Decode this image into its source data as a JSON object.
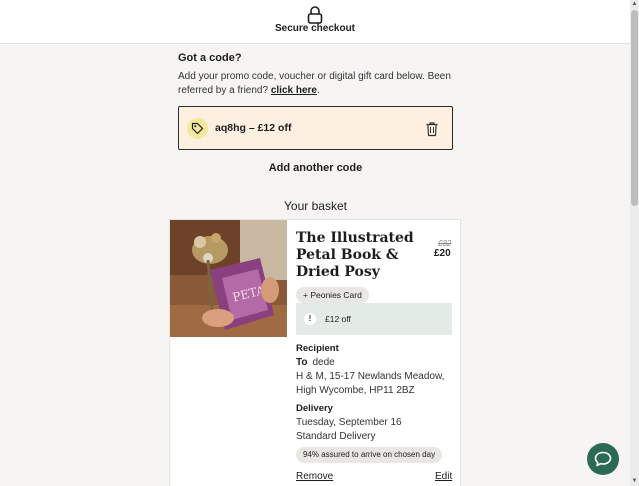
{
  "header": {
    "title": "Secure checkout",
    "icon": "lock-icon"
  },
  "promo": {
    "heading": "Got a code?",
    "description": "Add your promo code, voucher or digital gift card below. Been referred by a friend?",
    "referral_link": "click here",
    "referral_suffix": ".",
    "applied_code": "aq8hg – £12 off",
    "add_another": "Add another code"
  },
  "basket": {
    "title": "Your basket",
    "item": {
      "name": "The Illustrated Petal Book & Dried Posy",
      "price_old": "£32",
      "price_new": "£20",
      "addon": "+ Peonies Card",
      "discount": "£12 off",
      "recipient_heading": "Recipient",
      "to_label": "To",
      "to_name": "dede",
      "address_line1": "H & M, 15-17 Newlands Meadow,",
      "address_line2": "High Wycombe, HP11 2BZ",
      "delivery_heading": "Delivery",
      "delivery_date": "Tuesday, September 16",
      "delivery_type": "Standard Delivery",
      "assurance": "94% assured to arrive on chosen day",
      "remove_label": "Remove",
      "edit_label": "Edit"
    }
  },
  "colors": {
    "accent": "#2d6a55",
    "code_box_bg": "#fdf0e1",
    "discount_bg": "#e3ebe6",
    "tag_icon_bg": "#f6e89b"
  }
}
